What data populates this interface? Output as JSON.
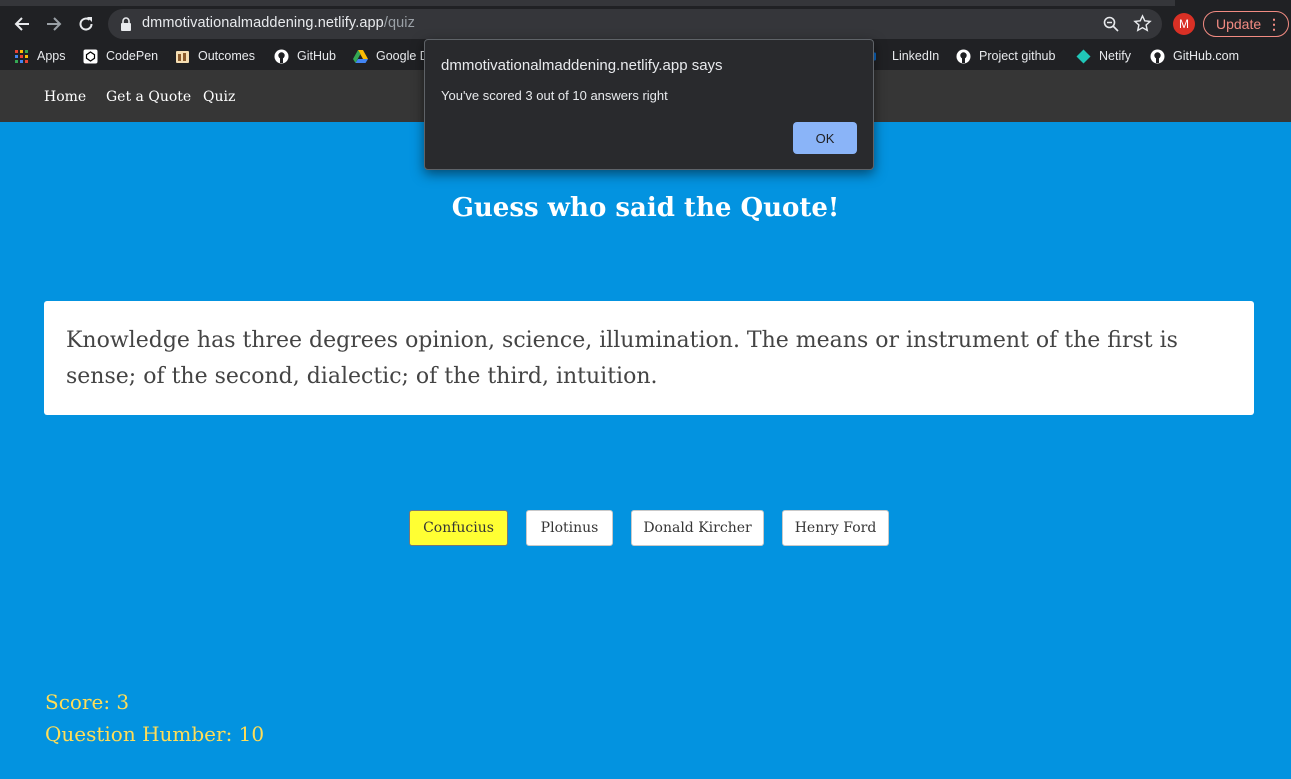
{
  "browser": {
    "url_host": "dmmotivationalmaddening.netlify.app",
    "url_path": "/quiz",
    "profile_initial": "M",
    "update_label": "Update",
    "bookmarks": [
      {
        "label": "Apps",
        "icon": "apps-grid-icon"
      },
      {
        "label": "CodePen",
        "icon": "codepen-icon"
      },
      {
        "label": "Outcomes",
        "icon": "outcomes-icon"
      },
      {
        "label": "GitHub",
        "icon": "github-icon"
      },
      {
        "label": "Google D",
        "icon": "google-drive-icon"
      },
      {
        "label": "LinkedIn",
        "icon": "linkedin-icon"
      },
      {
        "label": "Project github",
        "icon": "github-icon"
      },
      {
        "label": "Netify",
        "icon": "netlify-icon"
      },
      {
        "label": "GitHub.com",
        "icon": "github-icon"
      }
    ]
  },
  "nav": {
    "items": [
      "Home",
      "Get a Quote",
      "Quiz"
    ]
  },
  "quiz": {
    "heading": "Guess who said the Quote!",
    "quote": "Knowledge has three degrees opinion, science, illumination. The means or instrument of the first is sense; of the second, dialectic; of the third, intuition.",
    "answers": [
      {
        "label": "Confucius",
        "selected": true
      },
      {
        "label": "Plotinus",
        "selected": false
      },
      {
        "label": "Donald Kircher",
        "selected": false
      },
      {
        "label": "Henry Ford",
        "selected": false
      }
    ],
    "score_text": "Score: 3",
    "question_text": "Question Humber: 10"
  },
  "dialog": {
    "title": "dmmotivationalmaddening.netlify.app says",
    "message": "You've scored 3 out of 10 answers right",
    "ok_label": "OK"
  },
  "colors": {
    "page_bg": "#0393e0",
    "nav_bg": "#363636",
    "selected_answer": "#ffff33",
    "stats_text": "#ffdd57",
    "dialog_ok": "#8ab4f8"
  }
}
